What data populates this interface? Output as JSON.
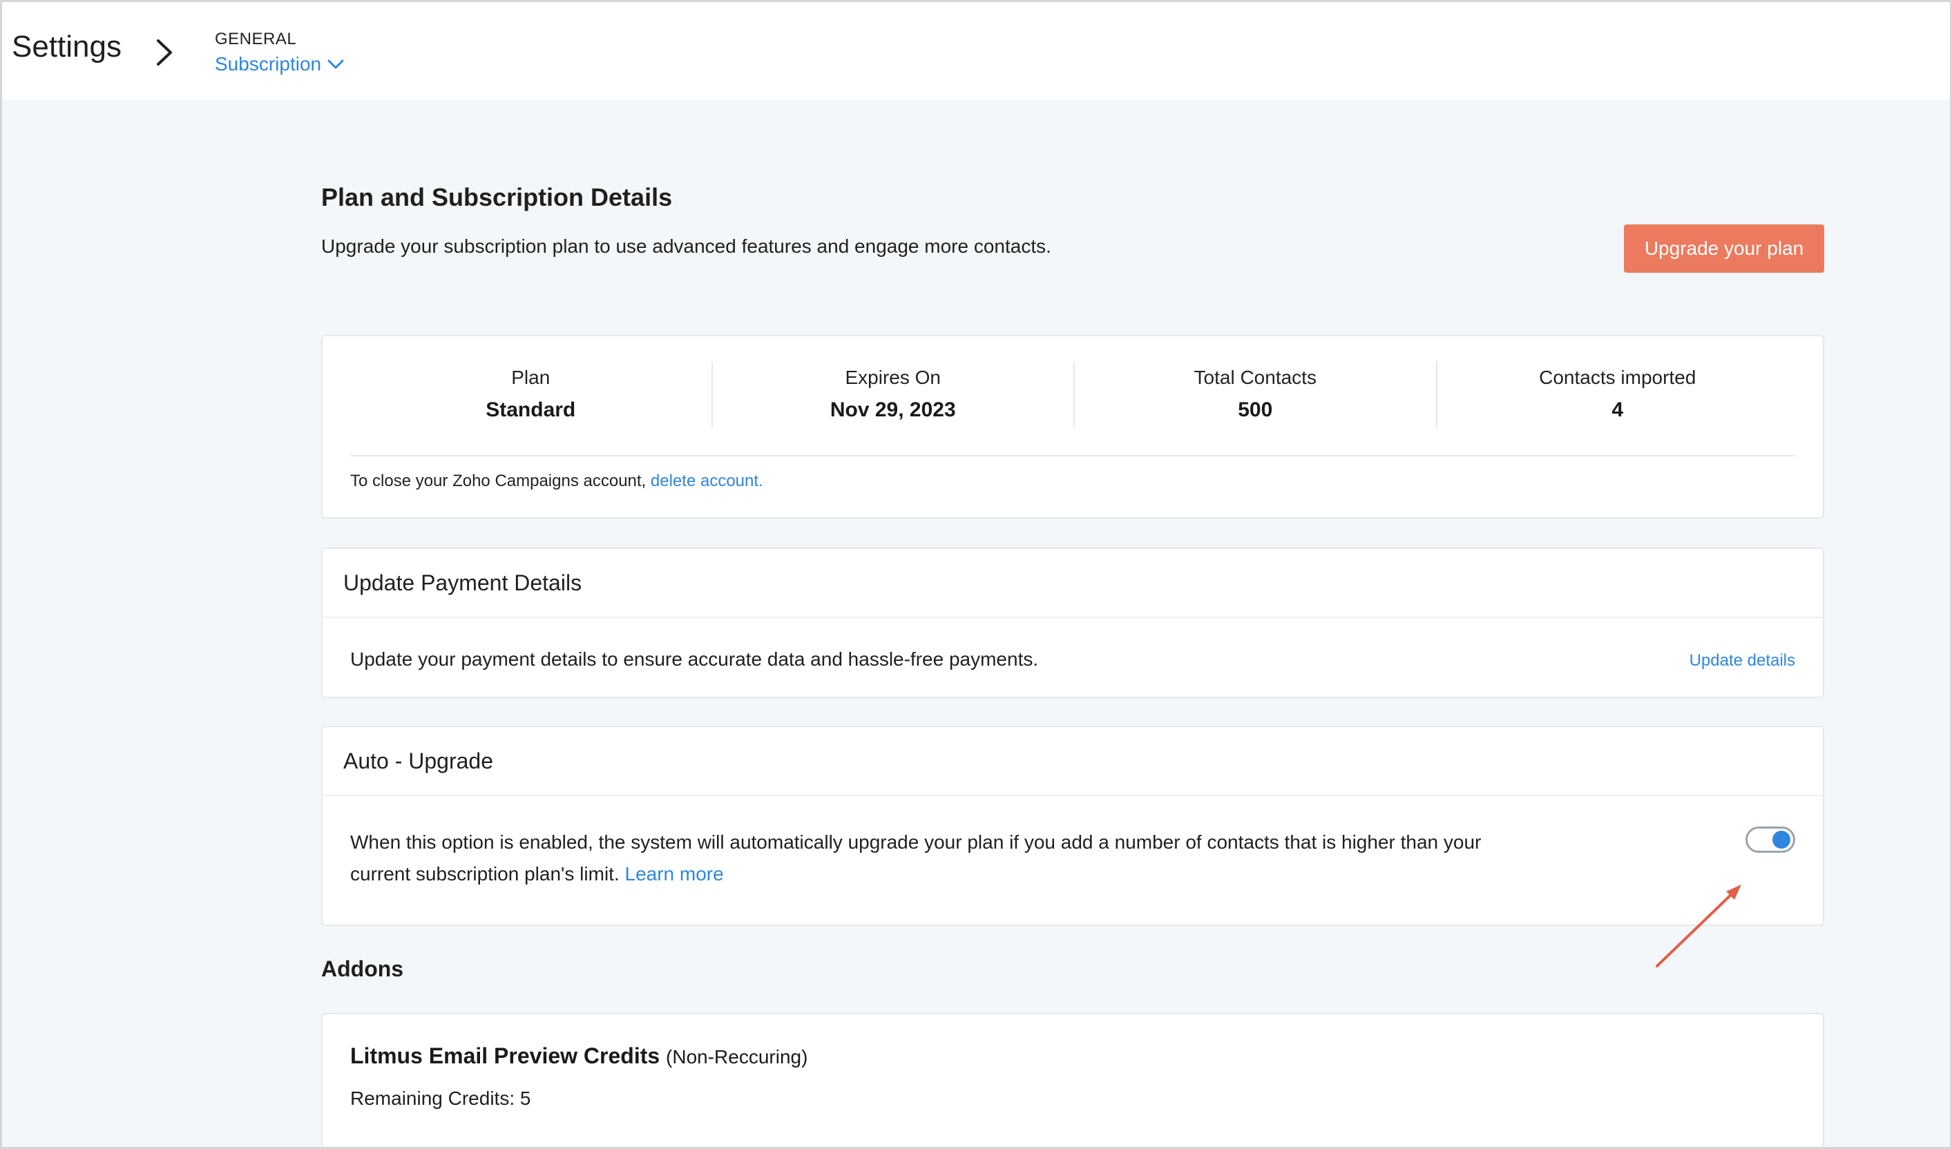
{
  "header": {
    "title": "Settings",
    "breadcrumb_group": "GENERAL",
    "breadcrumb_current": "Subscription"
  },
  "plan_section": {
    "title": "Plan and Subscription Details",
    "subtitle": "Upgrade your subscription plan to use advanced features and engage more contacts.",
    "upgrade_button": "Upgrade your plan",
    "stats": [
      {
        "label": "Plan",
        "value": "Standard"
      },
      {
        "label": "Expires On",
        "value": "Nov 29, 2023"
      },
      {
        "label": "Total Contacts",
        "value": "500"
      },
      {
        "label": "Contacts imported",
        "value": "4"
      }
    ],
    "close_note": "To close your Zoho Campaigns account,",
    "delete_link": "delete account."
  },
  "payment": {
    "title": "Update Payment Details",
    "text": "Update your payment details to ensure accurate data and hassle-free payments.",
    "link": "Update details"
  },
  "auto_upgrade": {
    "title": "Auto - Upgrade",
    "text": "When this option is enabled, the system will automatically upgrade your plan if you add a number of contacts that is higher than your current subscription plan's limit.",
    "learn_more": "Learn more",
    "enabled": true
  },
  "addons": {
    "title": "Addons",
    "items": [
      {
        "name": "Litmus Email Preview Credits",
        "type": "(Non-Reccuring)",
        "credits": "Remaining Credits: 5"
      }
    ]
  },
  "colors": {
    "accent": "#2e86de",
    "upgrade_button": "#ec7a5e",
    "annotation_arrow": "#e0604a"
  },
  "icons": {
    "breadcrumb_separator": "chevron-right-icon",
    "dropdown": "chevron-down-icon",
    "annotation": "arrow-annotation-icon"
  }
}
